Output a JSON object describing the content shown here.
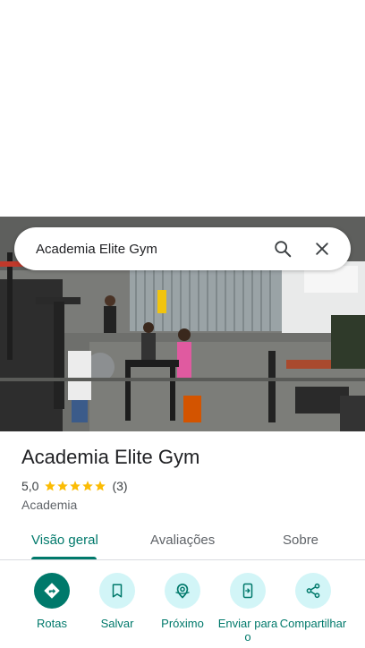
{
  "search": {
    "query": "Academia Elite Gym",
    "search_icon": "search-icon",
    "clear_icon": "close-icon"
  },
  "photo": {
    "description_icon": "gym-interior-photo"
  },
  "place": {
    "name": "Academia Elite Gym",
    "rating": "5,0",
    "stars": 5,
    "review_count": "(3)",
    "category": "Academia"
  },
  "tabs": [
    {
      "label": "Visão geral",
      "active": true
    },
    {
      "label": "Avaliações",
      "active": false
    },
    {
      "label": "Sobre",
      "active": false
    }
  ],
  "actions": [
    {
      "label": "Rotas",
      "icon": "directions-icon"
    },
    {
      "label": "Salvar",
      "icon": "bookmark-icon"
    },
    {
      "label": "Próximo",
      "icon": "nearby-icon"
    },
    {
      "label": "Enviar para o",
      "icon": "send-to-phone-icon"
    },
    {
      "label": "Compartilhar",
      "icon": "share-icon"
    }
  ],
  "colors": {
    "accent": "#00796b",
    "action_bg": "#d2f5f7",
    "star": "#fbbc04"
  }
}
